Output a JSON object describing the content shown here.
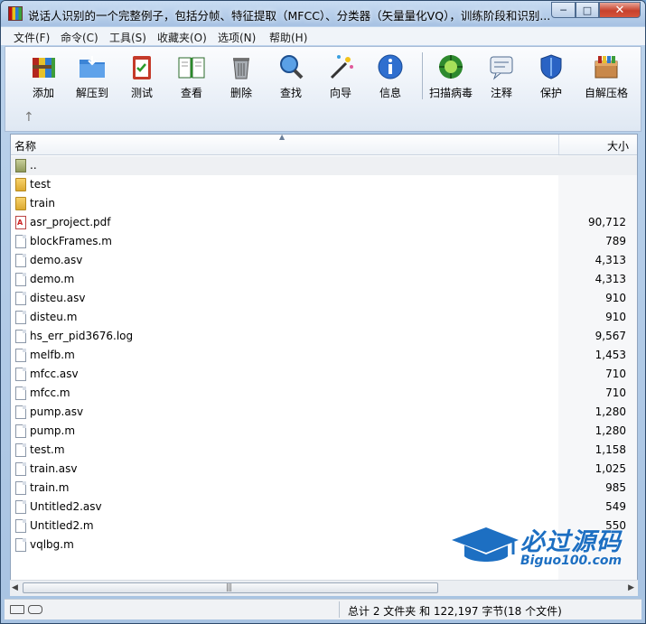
{
  "window": {
    "title": "说话人识别的一个完整例子，包括分帧、特征提取（MFCC）、分类器（矢量量化VQ），训练阶段和识别..."
  },
  "menu": [
    "文件(F)",
    "命令(C)",
    "工具(S)",
    "收藏夹(O)",
    "选项(N)",
    "帮助(H)"
  ],
  "toolbar": {
    "add": "添加",
    "extract": "解压到",
    "test": "测试",
    "view": "查看",
    "delete": "删除",
    "find": "查找",
    "wizard": "向导",
    "info": "信息",
    "virus": "扫描病毒",
    "comment": "注释",
    "protect": "保护",
    "sfx": "自解压格"
  },
  "columns": {
    "name": "名称",
    "size": "大小"
  },
  "files": [
    {
      "name": "..",
      "size": ""
    },
    {
      "name": "test",
      "size": ""
    },
    {
      "name": "train",
      "size": ""
    },
    {
      "name": "asr_project.pdf",
      "size": "90,712"
    },
    {
      "name": "blockFrames.m",
      "size": "789"
    },
    {
      "name": "demo.asv",
      "size": "4,313"
    },
    {
      "name": "demo.m",
      "size": "4,313"
    },
    {
      "name": "disteu.asv",
      "size": "910"
    },
    {
      "name": "disteu.m",
      "size": "910"
    },
    {
      "name": "hs_err_pid3676.log",
      "size": "9,567"
    },
    {
      "name": "melfb.m",
      "size": "1,453"
    },
    {
      "name": "mfcc.asv",
      "size": "710"
    },
    {
      "name": "mfcc.m",
      "size": "710"
    },
    {
      "name": "pump.asv",
      "size": "1,280"
    },
    {
      "name": "pump.m",
      "size": "1,280"
    },
    {
      "name": "test.m",
      "size": "1,158"
    },
    {
      "name": "train.asv",
      "size": "1,025"
    },
    {
      "name": "train.m",
      "size": "985"
    },
    {
      "name": "Untitled2.asv",
      "size": "549"
    },
    {
      "name": "Untitled2.m",
      "size": "550"
    },
    {
      "name": "vqlbg.m",
      "size": ""
    }
  ],
  "status": {
    "text": "总计 2 文件夹 和 122,197 字节(18 个文件)"
  },
  "watermark": {
    "title": "必过源码",
    "subtitle": "Biguo100.com"
  }
}
